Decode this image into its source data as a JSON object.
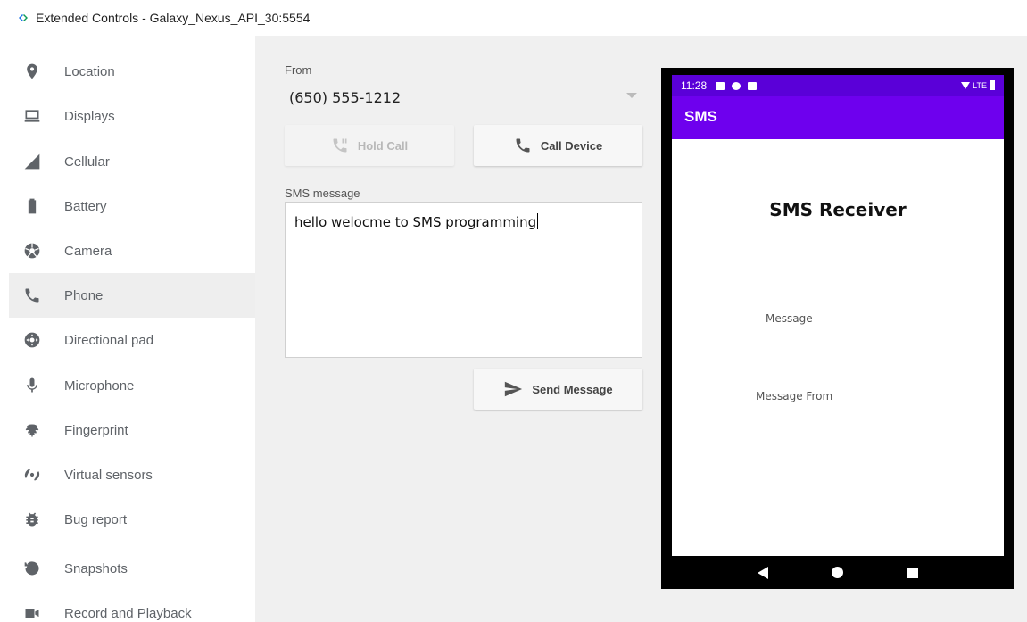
{
  "window": {
    "title": "Extended Controls - Galaxy_Nexus_API_30:5554"
  },
  "sidebar": {
    "items": [
      {
        "label": "Location",
        "icon": "location-pin-icon"
      },
      {
        "label": "Displays",
        "icon": "display-icon"
      },
      {
        "label": "Cellular",
        "icon": "cellular-signal-icon"
      },
      {
        "label": "Battery",
        "icon": "battery-icon"
      },
      {
        "label": "Camera",
        "icon": "camera-aperture-icon"
      },
      {
        "label": "Phone",
        "icon": "phone-icon",
        "active": true
      },
      {
        "label": "Directional pad",
        "icon": "dpad-icon"
      },
      {
        "label": "Microphone",
        "icon": "microphone-icon"
      },
      {
        "label": "Fingerprint",
        "icon": "fingerprint-icon"
      },
      {
        "label": "Virtual sensors",
        "icon": "rotation-icon"
      },
      {
        "label": "Bug report",
        "icon": "bug-icon"
      },
      {
        "label": "Snapshots",
        "icon": "history-icon"
      },
      {
        "label": "Record and Playback",
        "icon": "video-camera-icon"
      }
    ]
  },
  "phone_panel": {
    "from_label": "From",
    "from_value": "(650) 555-1212",
    "hold_call_label": "Hold Call",
    "call_device_label": "Call Device",
    "sms_label": "SMS message",
    "sms_value": "hello welocme to SMS programming",
    "send_label": "Send Message"
  },
  "device": {
    "status_time": "11:28",
    "status_network": "LTE",
    "app_title": "SMS",
    "screen_title": "SMS Receiver",
    "message_label": "Message",
    "message_from_label": "Message From"
  },
  "colors": {
    "status_bar": "#5a00d8",
    "app_bar": "#6e00ee",
    "panel_bg": "#f0f0f0",
    "active_nav": "#eeeeee"
  }
}
